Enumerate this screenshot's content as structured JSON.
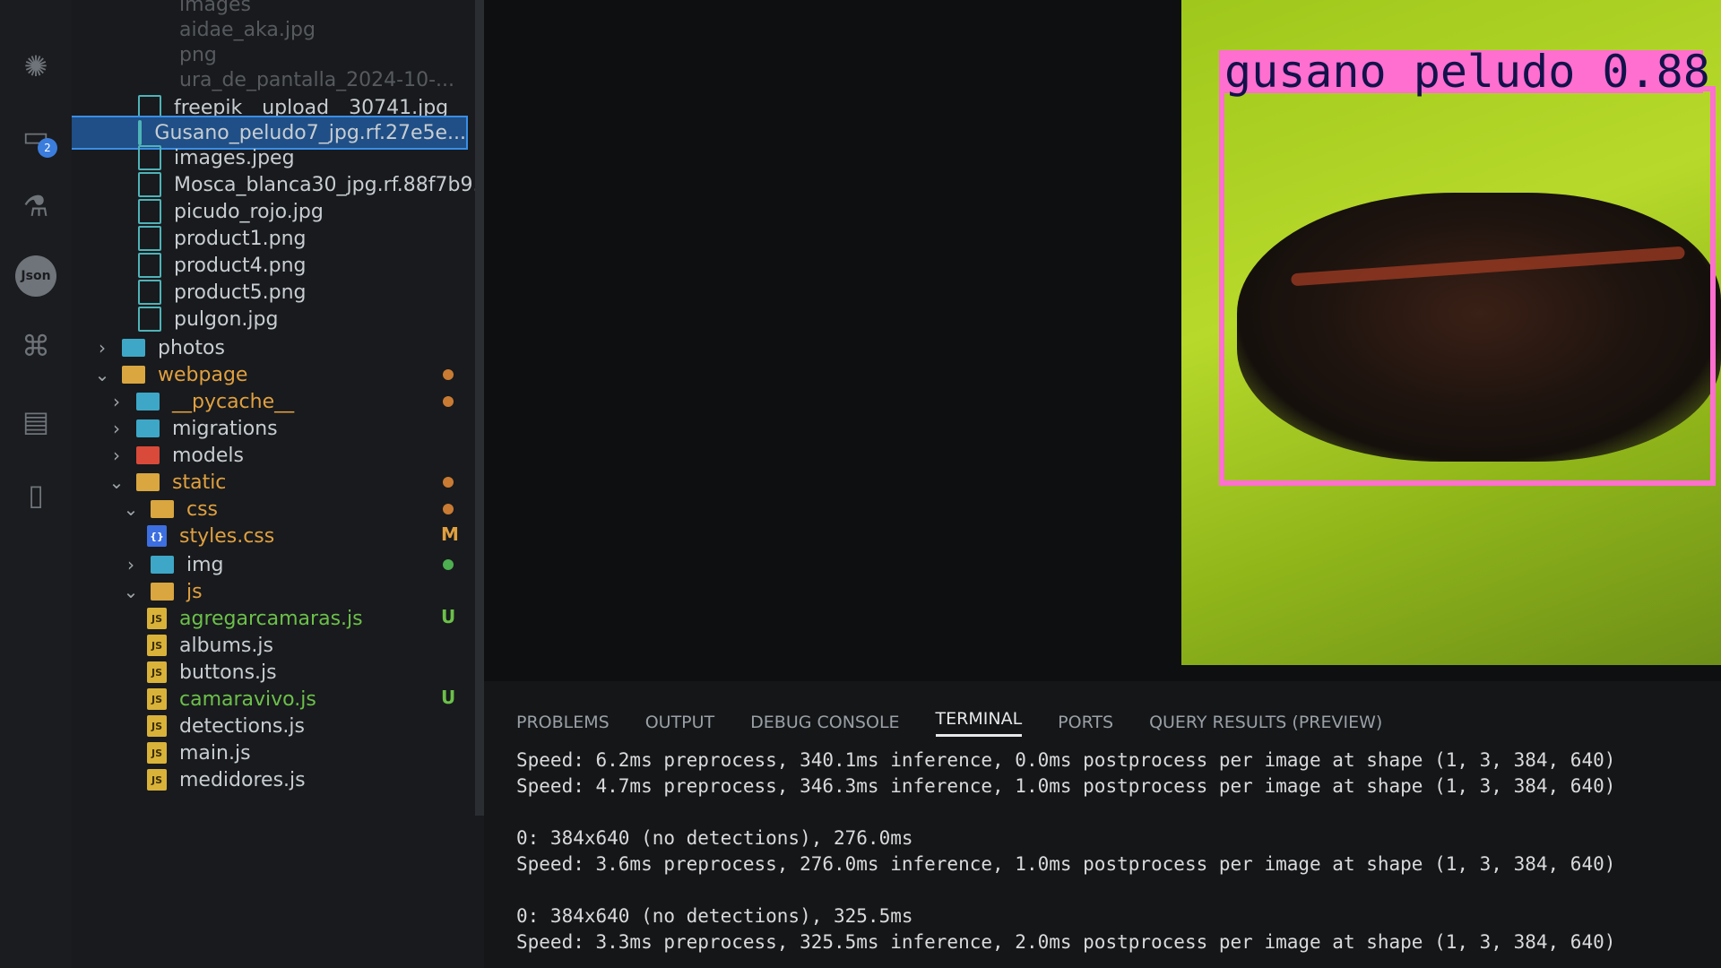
{
  "activity_bar": {
    "icons": [
      "run-debug-icon",
      "remote-explorer-icon",
      "testing-icon",
      "json-icon",
      "python-icon",
      "database-icon",
      "notebook-icon"
    ],
    "json_text": "Json",
    "remote_badge": "2"
  },
  "explorer": {
    "faded_items": [
      "images",
      "aidae_aka.jpg",
      "png",
      "ura_de_pantalla_2024-10-..."
    ],
    "items": [
      {
        "label": "freepik__upload__30741.jpg",
        "type": "image"
      },
      {
        "label": "Gusano_peludo7_jpg.rf.27e5e...",
        "type": "image",
        "selected": true
      },
      {
        "label": "images.jpeg",
        "type": "image"
      },
      {
        "label": "Mosca_blanca30_jpg.rf.88f7b9...",
        "type": "image"
      },
      {
        "label": "picudo_rojo.jpg",
        "type": "image"
      },
      {
        "label": "product1.png",
        "type": "image"
      },
      {
        "label": "product4.png",
        "type": "image"
      },
      {
        "label": "product5.png",
        "type": "image"
      },
      {
        "label": "pulgon.jpg",
        "type": "image"
      },
      {
        "label": "photos",
        "type": "folder",
        "collapsed": true
      },
      {
        "label": "webpage",
        "type": "folder-open",
        "status": "dot"
      },
      {
        "label": "__pycache__",
        "type": "folder",
        "collapsed": true,
        "status": "dot"
      },
      {
        "label": "migrations",
        "type": "folder",
        "collapsed": true
      },
      {
        "label": "models",
        "type": "folder-red",
        "collapsed": true
      },
      {
        "label": "static",
        "type": "folder-open",
        "status": "dot"
      },
      {
        "label": "css",
        "type": "folder-open",
        "status": "dot"
      },
      {
        "label": "styles.css",
        "type": "css",
        "status": "M"
      },
      {
        "label": "img",
        "type": "folder",
        "collapsed": true,
        "status": "dot-green"
      },
      {
        "label": "js",
        "type": "folder-open"
      },
      {
        "label": "agregarcamaras.js",
        "type": "js",
        "status": "U"
      },
      {
        "label": "albums.js",
        "type": "js"
      },
      {
        "label": "buttons.js",
        "type": "js"
      },
      {
        "label": "camaravivo.js",
        "type": "js",
        "status": "U"
      },
      {
        "label": "detections.js",
        "type": "js"
      },
      {
        "label": "main.js",
        "type": "js"
      },
      {
        "label": "medidores.js",
        "type": "js"
      }
    ]
  },
  "preview": {
    "detection_label": "gusano peludo 0.88",
    "box_color": "#ff6fd0"
  },
  "panel": {
    "tabs": [
      "PROBLEMS",
      "OUTPUT",
      "DEBUG CONSOLE",
      "TERMINAL",
      "PORTS",
      "QUERY RESULTS (PREVIEW)"
    ],
    "active_tab": "TERMINAL",
    "terminal_lines": [
      "Speed: 6.2ms preprocess, 340.1ms inference, 0.0ms postprocess per image at shape (1, 3, 384, 640)",
      "Speed: 4.7ms preprocess, 346.3ms inference, 1.0ms postprocess per image at shape (1, 3, 384, 640)",
      "",
      "0: 384x640 (no detections), 276.0ms",
      "Speed: 3.6ms preprocess, 276.0ms inference, 1.0ms postprocess per image at shape (1, 3, 384, 640)",
      "",
      "0: 384x640 (no detections), 325.5ms",
      "Speed: 3.3ms preprocess, 325.5ms inference, 2.0ms postprocess per image at shape (1, 3, 384, 640)"
    ]
  },
  "colors": {
    "modified": "#e0a040",
    "untracked": "#6cc04a",
    "selection": "#1f4f86"
  }
}
